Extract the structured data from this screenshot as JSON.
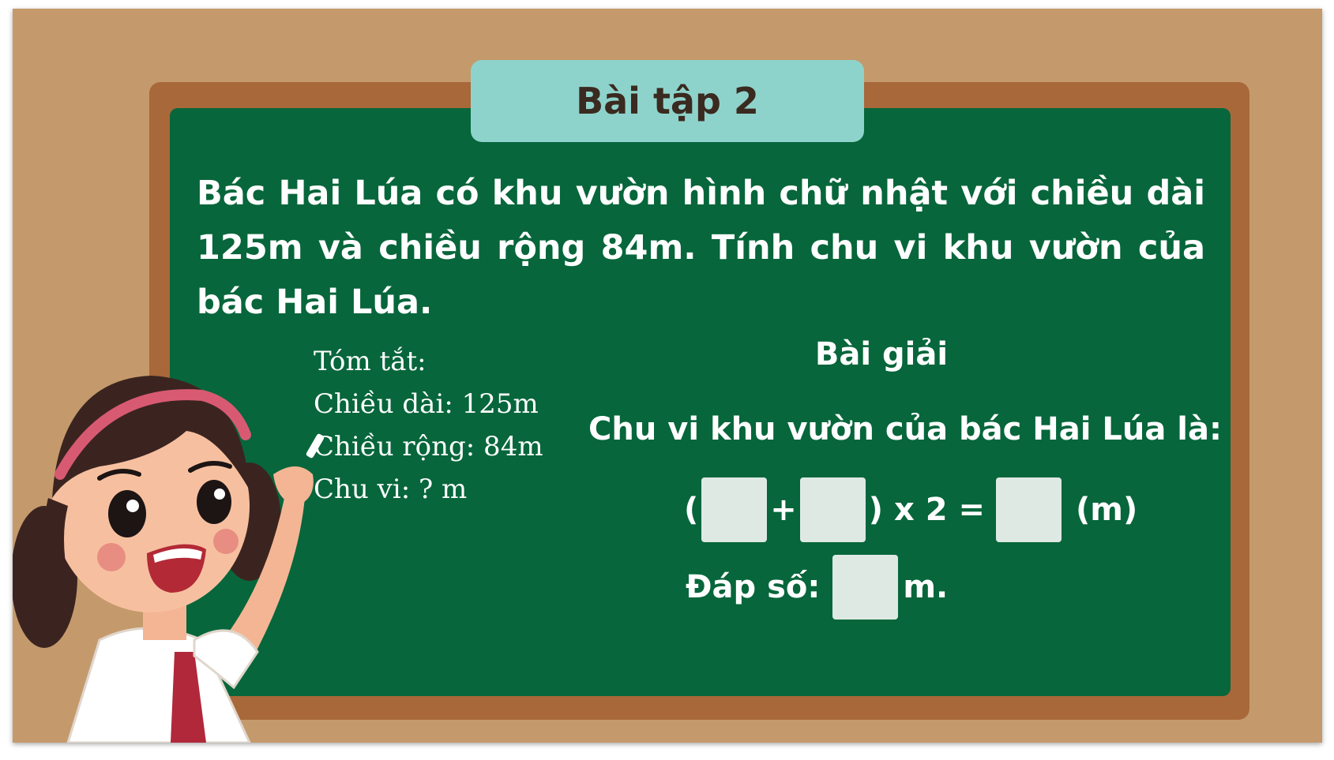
{
  "title": "Bài tập 2",
  "problem": "Bác Hai Lúa có khu vườn hình chữ nhật với chiều dài 125m và chiều rộng 84m. Tính chu vi khu vườn của bác Hai Lúa.",
  "summary": {
    "heading": "Tóm tắt:",
    "length": "Chiều dài: 125m",
    "width": "Chiều rộng: 84m",
    "perimeter": "Chu vi: ? m"
  },
  "solution": {
    "heading": "Bài giải",
    "statement": "Chu vi khu vườn của bác Hai Lúa là:",
    "open_paren": "(",
    "plus": "+",
    "times_two": ") x 2 =",
    "unit": "(m)",
    "answer_label": "Đáp số:",
    "answer_unit": "m."
  },
  "colors": {
    "background": "#c49a6c",
    "frame": "#a8683a",
    "board": "#07663b",
    "title_tab": "#8ed3cb",
    "answer_box": "#dfe9e4"
  }
}
